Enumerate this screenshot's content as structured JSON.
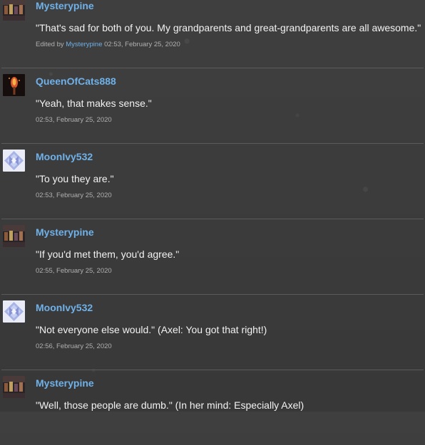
{
  "comments": [
    {
      "author": "Mysterypine",
      "avatar_icon": "mysterypine-avatar-icon",
      "text": "\"That's sad for both of you. My grandparents and great-grandparents are all awesome.\"",
      "edited_prefix": "Edited by",
      "edited_by": "Mysterypine",
      "timestamp": "02:53, February 25, 2020"
    },
    {
      "author": "QueenOfCats888",
      "avatar_icon": "queenofcats-avatar-icon",
      "text": "\"Yeah, that makes sense.\"",
      "timestamp": "02:53, February 25, 2020"
    },
    {
      "author": "MoonIvy532",
      "avatar_icon": "moonivy-avatar-icon",
      "text": "\"To you they are.\"",
      "timestamp": "02:53, February 25, 2020"
    },
    {
      "author": "Mysterypine",
      "avatar_icon": "mysterypine-avatar-icon",
      "text": "\"If you'd met them, you'd agree.\"",
      "timestamp": "02:55, February 25, 2020"
    },
    {
      "author": "MoonIvy532",
      "avatar_icon": "moonivy-avatar-icon",
      "text": "\"Not everyone else would.\" (Axel: You got that right!)",
      "timestamp": "02:56, February 25, 2020"
    },
    {
      "author": "Mysterypine",
      "avatar_icon": "mysterypine-avatar-icon",
      "text": "\"Well, those people are dumb.\" (In her mind: Especially Axel)",
      "timestamp": ""
    }
  ],
  "colors": {
    "background": "#3b3b3b",
    "username": "#6fb1e8",
    "text": "#f2f2f2",
    "meta": "#b0b0b0",
    "divider": "#5b5b5b"
  }
}
